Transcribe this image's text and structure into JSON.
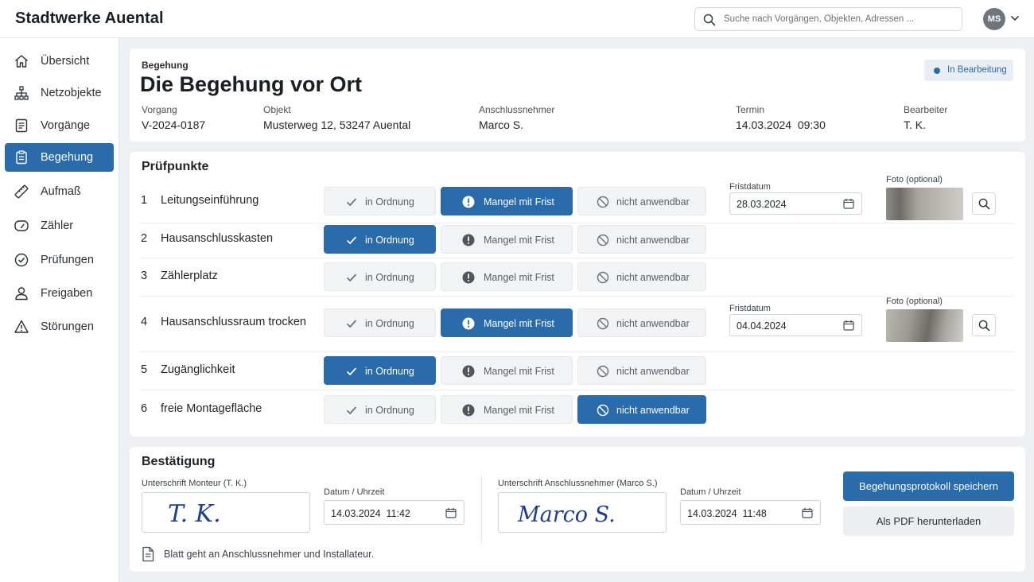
{
  "app": {
    "brand": "Stadtwerke Auental"
  },
  "search": {
    "placeholder": "Suche nach Vorgängen, Objekten, Adressen ..."
  },
  "user": {
    "initials": "MS"
  },
  "sidebar": {
    "items": [
      {
        "label": "Übersicht",
        "icon": "home-icon"
      },
      {
        "label": "Netzobjekte",
        "icon": "network-icon"
      },
      {
        "label": "Vorgänge",
        "icon": "document-list-icon"
      },
      {
        "label": "Begehung",
        "icon": "clipboard-icon",
        "active": true
      },
      {
        "label": "Aufmaß",
        "icon": "ruler-icon"
      },
      {
        "label": "Zähler",
        "icon": "gauge-icon"
      },
      {
        "label": "Prüfungen",
        "icon": "check-circle-icon"
      },
      {
        "label": "Freigaben",
        "icon": "user-icon"
      },
      {
        "label": "Störungen",
        "icon": "warning-icon"
      }
    ]
  },
  "header": {
    "kicker": "Begehung",
    "title": "Die Begehung vor Ort",
    "status": "In Bearbeitung",
    "vorgang_label": "Vorgang",
    "vorgang": "V-2024-0187",
    "objekt_label": "Objekt",
    "objekt": "Musterweg 12, 53247 Auental",
    "anschluss_label": "Anschlussnehmer",
    "anschluss": "Marco S.",
    "termin_label": "Termin",
    "termin": "14.03.2024  09:30",
    "bearbeiter_label": "Bearbeiter",
    "bearbeiter": "T. K."
  },
  "pruefpunkte": {
    "title": "Prüfpunkte",
    "option_ok": "in Ordnung",
    "option_mangel": "Mangel mit Frist",
    "option_na": "nicht anwendbar",
    "frist_label": "Fristdatum",
    "foto_label": "Foto (optional)",
    "rows": [
      {
        "nr": "1",
        "name": "Leitungseinführung",
        "selected": "mangel",
        "frist": "28.03.2024"
      },
      {
        "nr": "2",
        "name": "Hausanschlusskasten",
        "selected": "ok"
      },
      {
        "nr": "3",
        "name": "Zählerplatz",
        "selected": "none"
      },
      {
        "nr": "4",
        "name": "Hausanschlussraum trocken",
        "selected": "mangel",
        "frist": "04.04.2024"
      },
      {
        "nr": "5",
        "name": "Zugänglichkeit",
        "selected": "ok"
      },
      {
        "nr": "6",
        "name": "freie Montagefläche",
        "selected": "na"
      }
    ]
  },
  "bestaetigung": {
    "title": "Bestätigung",
    "sig1_label": "Unterschrift Monteur (T. K.)",
    "sig1_text": "T. K.",
    "date1_label": "Datum / Uhrzeit",
    "date1": "14.03.2024  11:42",
    "sig2_label": "Unterschrift Anschlussnehmer (Marco S.)",
    "sig2_text": "Marco S.",
    "date2_label": "Datum / Uhrzeit",
    "date2": "14.03.2024  11:48",
    "save_button": "Begehungsprotokoll speichern",
    "pdf_button": "Als PDF herunterladen",
    "note": "Blatt geht an Anschlussnehmer und Installateur."
  },
  "colors": {
    "accent": "#2a6bab",
    "background": "#eef0f3"
  }
}
